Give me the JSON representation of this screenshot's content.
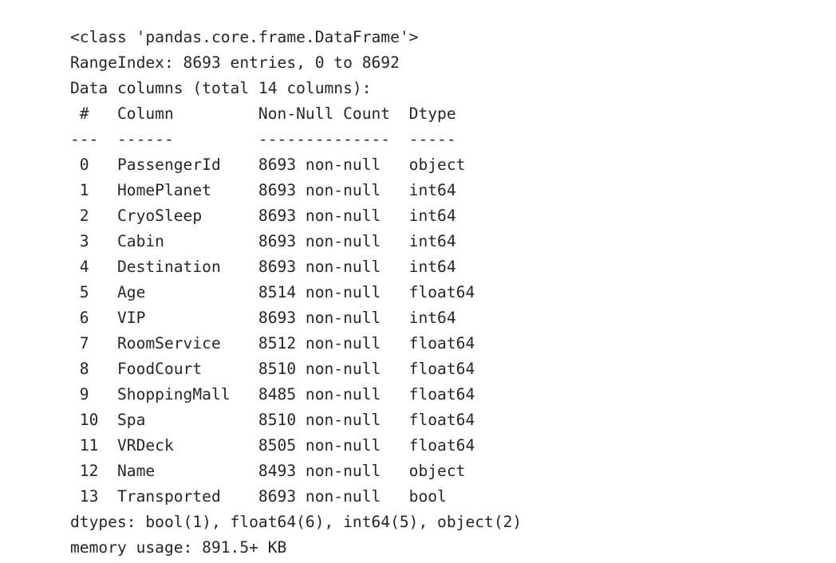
{
  "theme": {
    "background": "#ffffff",
    "text_color": "#262626"
  },
  "output": {
    "kind": "pandas-dataframe-info",
    "class_line": "<class 'pandas.core.frame.DataFrame'>",
    "range_index_line": "RangeIndex: 8693 entries, 0 to 8692",
    "data_columns_line": "Data columns (total 14 columns):",
    "header_line": " #   Column         Non-Null Count  Dtype  ",
    "separator_line": "---  ------         --------------  -----  ",
    "dtypes_line": "dtypes: bool(1), float64(6), int64(5), object(2)",
    "memory_usage_line": "memory usage: 891.5+ KB",
    "headers": {
      "index": "#",
      "column": "Column",
      "non_null_count": "Non-Null Count",
      "dtype": "Dtype"
    },
    "separators": {
      "index": "---",
      "column": "------",
      "non_null_count": "--------------",
      "dtype": "-----"
    },
    "summary": {
      "total_entries": 8693,
      "index_start": 0,
      "index_end": 8692,
      "total_columns": 14,
      "memory_usage": "891.5+ KB",
      "dtype_counts": {
        "bool": 1,
        "float64": 6,
        "int64": 5,
        "object": 2
      }
    },
    "rows": [
      {
        "index": "0",
        "column": "PassengerId",
        "non_null_count": "8693 non-null",
        "dtype": "object",
        "line": " 0   PassengerId    8693 non-null   object "
      },
      {
        "index": "1",
        "column": "HomePlanet",
        "non_null_count": "8693 non-null",
        "dtype": "int64",
        "line": " 1   HomePlanet     8693 non-null   int64  "
      },
      {
        "index": "2",
        "column": "CryoSleep",
        "non_null_count": "8693 non-null",
        "dtype": "int64",
        "line": " 2   CryoSleep      8693 non-null   int64  "
      },
      {
        "index": "3",
        "column": "Cabin",
        "non_null_count": "8693 non-null",
        "dtype": "int64",
        "line": " 3   Cabin          8693 non-null   int64  "
      },
      {
        "index": "4",
        "column": "Destination",
        "non_null_count": "8693 non-null",
        "dtype": "int64",
        "line": " 4   Destination    8693 non-null   int64  "
      },
      {
        "index": "5",
        "column": "Age",
        "non_null_count": "8514 non-null",
        "dtype": "float64",
        "line": " 5   Age            8514 non-null   float64"
      },
      {
        "index": "6",
        "column": "VIP",
        "non_null_count": "8693 non-null",
        "dtype": "int64",
        "line": " 6   VIP            8693 non-null   int64  "
      },
      {
        "index": "7",
        "column": "RoomService",
        "non_null_count": "8512 non-null",
        "dtype": "float64",
        "line": " 7   RoomService    8512 non-null   float64"
      },
      {
        "index": "8",
        "column": "FoodCourt",
        "non_null_count": "8510 non-null",
        "dtype": "float64",
        "line": " 8   FoodCourt      8510 non-null   float64"
      },
      {
        "index": "9",
        "column": "ShoppingMall",
        "non_null_count": "8485 non-null",
        "dtype": "float64",
        "line": " 9   ShoppingMall   8485 non-null   float64"
      },
      {
        "index": "10",
        "column": "Spa",
        "non_null_count": "8510 non-null",
        "dtype": "float64",
        "line": " 10  Spa            8510 non-null   float64"
      },
      {
        "index": "11",
        "column": "VRDeck",
        "non_null_count": "8505 non-null",
        "dtype": "float64",
        "line": " 11  VRDeck         8505 non-null   float64"
      },
      {
        "index": "12",
        "column": "Name",
        "non_null_count": "8493 non-null",
        "dtype": "object",
        "line": " 12  Name           8493 non-null   object "
      },
      {
        "index": "13",
        "column": "Transported",
        "non_null_count": "8693 non-null",
        "dtype": "bool",
        "line": " 13  Transported    8693 non-null   bool   "
      }
    ]
  }
}
